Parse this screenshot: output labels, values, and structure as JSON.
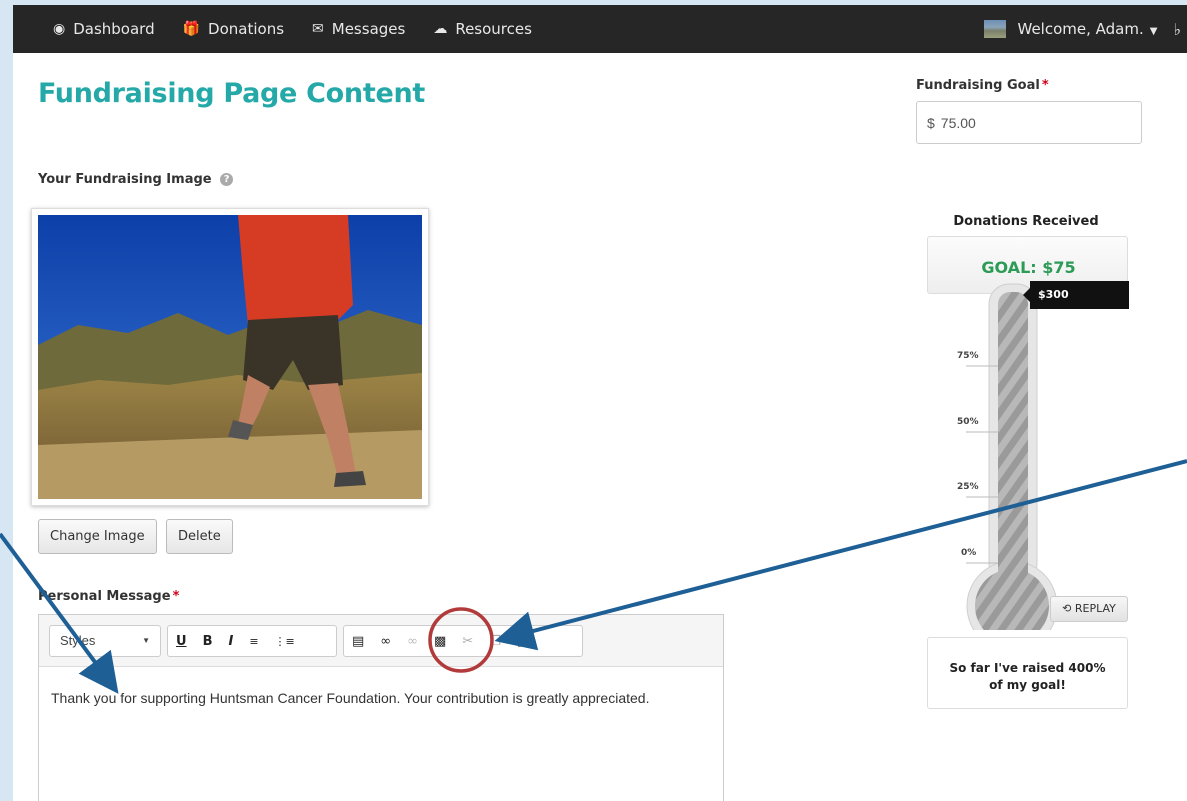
{
  "nav": {
    "items": [
      {
        "label": "Dashboard",
        "icon": "dashboard-icon"
      },
      {
        "label": "Donations",
        "icon": "gift-icon"
      },
      {
        "label": "Messages",
        "icon": "envelope-icon"
      },
      {
        "label": "Resources",
        "icon": "cloud-icon"
      }
    ],
    "welcome": "Welcome, Adam."
  },
  "page_title": "Fundraising Page Content",
  "image_section": {
    "label": "Your Fundraising Image",
    "change_button": "Change Image",
    "delete_button": "Delete"
  },
  "message_section": {
    "label": "Personal Message",
    "styles_select": "Styles",
    "body": "Thank you for supporting Huntsman Cancer Foundation. Your contribution is greatly appreciated."
  },
  "goal": {
    "label": "Fundraising Goal",
    "currency": "$",
    "value": "75.00"
  },
  "thermometer": {
    "title": "Donations Received",
    "goal_text": "GOAL: $75",
    "raised_tag": "$300",
    "ticks": [
      "75%",
      "50%",
      "25%",
      "0%"
    ],
    "fill_fraction": 1.0,
    "replay": "REPLAY",
    "summary": "So far I've raised 400% of my goal!"
  },
  "colors": {
    "title": "#25a8a8",
    "goal_green": "#2b9b55",
    "nav_bg": "#262626",
    "annotation": "#1e5f96",
    "circle": "#b23a3a"
  }
}
